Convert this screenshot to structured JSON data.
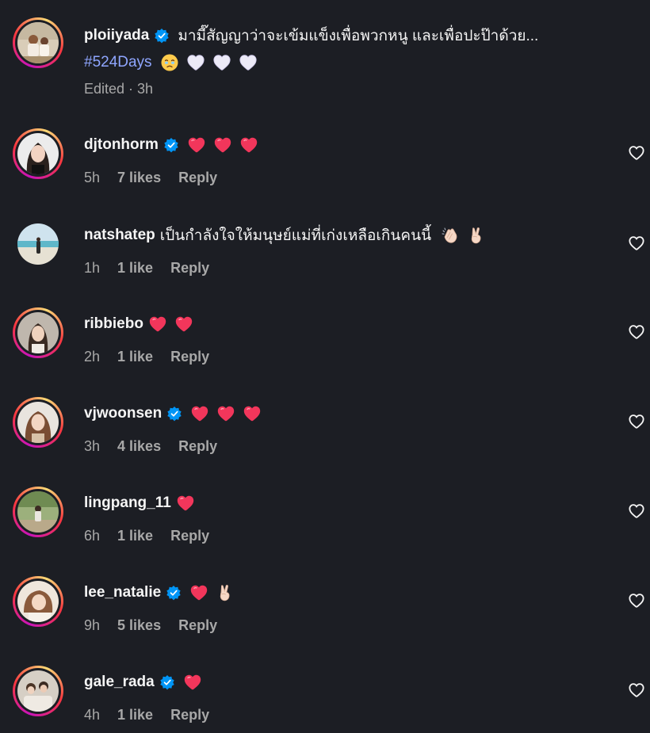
{
  "post": {
    "username": "ploiiyada",
    "caption": "มามี๊สัญญาว่าจะเข้มแข็งเพื่อพวกหนู และเพื่อปะป๊าด้วย...",
    "hashtag": "#524Days",
    "edited": "Edited",
    "time": "3h",
    "separator": "·"
  },
  "comments": [
    {
      "username": "djtonhorm",
      "text": "",
      "time": "5h",
      "likes": "7 likes",
      "reply": "Reply"
    },
    {
      "username": "natshatep",
      "text": "เป็นกำลังใจให้มนุษย์แม่ที่เก่งเหลือเกินคนนี้",
      "time": "1h",
      "likes": "1 like",
      "reply": "Reply"
    },
    {
      "username": "ribbiebo",
      "text": "",
      "time": "2h",
      "likes": "1 like",
      "reply": "Reply"
    },
    {
      "username": "vjwoonsen",
      "text": "",
      "time": "3h",
      "likes": "4 likes",
      "reply": "Reply"
    },
    {
      "username": "lingpang_11",
      "text": "",
      "time": "6h",
      "likes": "1 like",
      "reply": "Reply"
    },
    {
      "username": "lee_natalie",
      "text": "",
      "time": "9h",
      "likes": "5 likes",
      "reply": "Reply"
    },
    {
      "username": "gale_rada",
      "text": "",
      "time": "4h",
      "likes": "1 like",
      "reply": "Reply"
    }
  ],
  "colors": {
    "background": "#1c1e24",
    "text": "#f5f5f5",
    "muted": "#a8a8a8",
    "hashtag": "#8fa6ff",
    "verified": "#0095f6",
    "heart": "#f2365b"
  },
  "icons": {
    "verified": "verified-badge-icon",
    "like": "heart-outline-icon",
    "heart_emoji": "red-heart-emoji",
    "white_heart_emoji": "white-heart-emoji",
    "crying_emoji": "holding-back-tears-emoji",
    "clap_emoji": "clapping-hands-emoji",
    "victory_emoji": "victory-hand-emoji"
  }
}
